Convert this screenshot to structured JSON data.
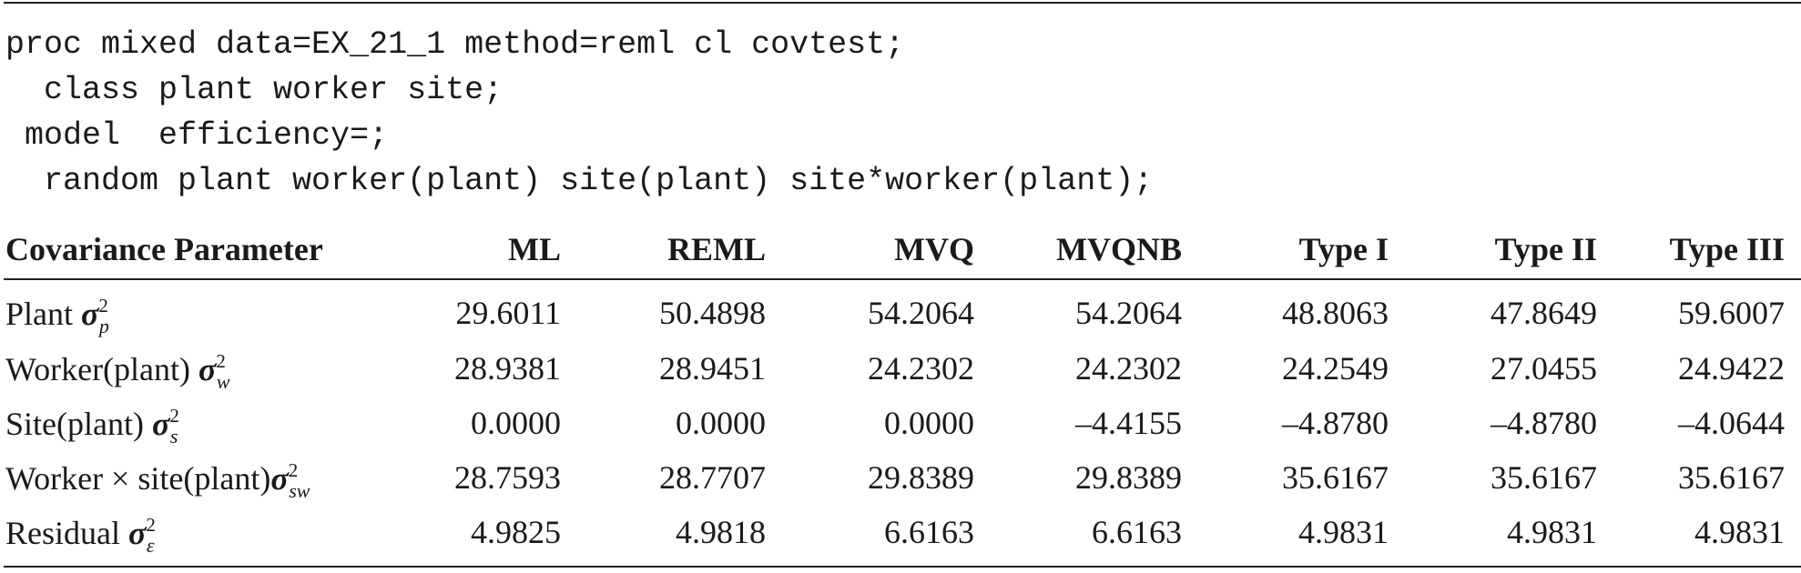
{
  "code": [
    "proc mixed data=EX_21_1 method=reml cl covtest;",
    "  class plant worker site;",
    " model  efficiency=;",
    "  random plant worker(plant) site(plant) site*worker(plant);"
  ],
  "table": {
    "headers": [
      "Covariance Parameter",
      "ML",
      "REML",
      "MVQ",
      "MVQNB",
      "Type I",
      "Type II",
      "Type III"
    ],
    "rows": [
      {
        "label": "Plant ",
        "symbol": "σ",
        "sup": "2",
        "sub": "p",
        "values": [
          "29.6011",
          "50.4898",
          "54.2064",
          "54.2064",
          "48.8063",
          "47.8649",
          "59.6007"
        ]
      },
      {
        "label": "Worker(plant) ",
        "symbol": "σ",
        "sup": "2",
        "sub": "w",
        "values": [
          "28.9381",
          "28.9451",
          "24.2302",
          "24.2302",
          "24.2549",
          "27.0455",
          "24.9422"
        ]
      },
      {
        "label": "Site(plant) ",
        "symbol": "σ",
        "sup": "2",
        "sub": "s",
        "values": [
          "0.0000",
          "0.0000",
          "0.0000",
          "–4.4155",
          "–4.8780",
          "–4.8780",
          "–4.0644"
        ]
      },
      {
        "label": "Worker × site(plant)",
        "symbol": "σ",
        "sup": "2",
        "sub": "sw",
        "values": [
          "28.7593",
          "28.7707",
          "29.8389",
          "29.8389",
          "35.6167",
          "35.6167",
          "35.6167"
        ]
      },
      {
        "label": "Residual ",
        "symbol": "σ",
        "sup": "2",
        "sub": "ε",
        "values": [
          "4.9825",
          "4.9818",
          "6.6163",
          "6.6163",
          "4.9831",
          "4.9831",
          "4.9831"
        ]
      }
    ]
  }
}
